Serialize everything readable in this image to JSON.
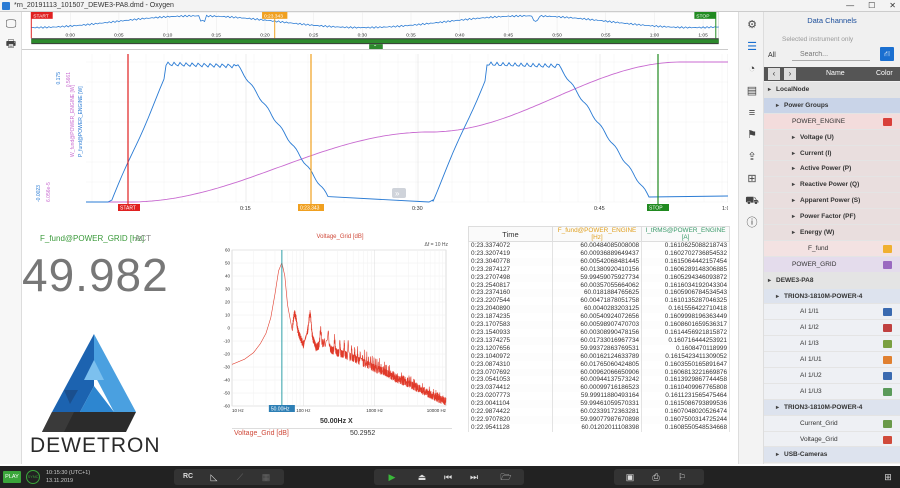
{
  "window": {
    "title": "*rn_20191113_101507_DEWE3-PA8.dmd - Oxygen",
    "controls": [
      "—",
      "☐",
      "✕"
    ]
  },
  "overview": {
    "start_marker": "START",
    "cursor_marker": "0:23.343",
    "stop_marker": "STOP",
    "ticks": [
      "0:00",
      "0:05",
      "0:10",
      "0:15",
      "0:20",
      "0:25",
      "0:30",
      "0:35",
      "0:40",
      "0:45",
      "0:50",
      "0:55",
      "1:00",
      "1:05"
    ]
  },
  "main_chart": {
    "axis_labels": [
      "W_fund@POWER_ENGINE [W]",
      "P_fund@POWER_ENGINE [W]"
    ],
    "y_ticks_top": [
      "0.5661",
      "0.175"
    ],
    "y_ticks_bottom": [
      "6.056e-5",
      "-0.0023"
    ],
    "start_marker": "START",
    "cursor_marker": "0:23.343",
    "stop_marker": "STOP",
    "x_ticks": [
      "0:15",
      "0:30",
      "0:45",
      "1:00"
    ],
    "colors": {
      "blue": "#2a7bd4",
      "magenta": "#c86ad0",
      "red": "#e02020",
      "orange": "#f0a020",
      "green": "#208a20"
    }
  },
  "fund_panel": {
    "label": "F_fund@POWER_GRID [Hz]",
    "mode": "ACT",
    "value": "49.982"
  },
  "logo": {
    "text": "DEWETRON"
  },
  "fft": {
    "title": "Voltage_Grid [dB]",
    "delta_label": "Δf = 10 Hz",
    "y_ticks": [
      "60",
      "50",
      "40",
      "30",
      "20",
      "10",
      "0",
      "-10",
      "-20",
      "-30",
      "-40",
      "-50",
      "-60"
    ],
    "x_ticks": [
      "10 Hz",
      "100 Hz",
      "1000 Hz",
      "10000 Hz"
    ],
    "cursor_label": "50.00Hz",
    "cursor_x_label": "50.00Hz X",
    "channel_name": "Voltage_Grid [dB]",
    "channel_value": "50.2952",
    "chart_data": {
      "type": "line",
      "title": "Voltage_Grid [dB]",
      "xlabel": "",
      "ylabel": "",
      "x_scale": "log",
      "xlim": [
        10,
        10000
      ],
      "ylim": [
        -60,
        60
      ],
      "series": [
        {
          "x": [
            10,
            15,
            20,
            25,
            30,
            35,
            40,
            45,
            50,
            55,
            60,
            70,
            80,
            100,
            120,
            150,
            200,
            250,
            300,
            400,
            500,
            700,
            1000,
            1500,
            2000,
            3000,
            5000,
            7000,
            10000
          ],
          "y": [
            -28,
            -24,
            -19,
            -12,
            -4,
            8,
            26,
            44,
            50.3,
            40,
            18,
            -2,
            5,
            -8,
            6,
            -10,
            -6,
            -12,
            -14,
            -16,
            -18,
            -22,
            -26,
            -30,
            -34,
            -38,
            -44,
            -48,
            -52
          ]
        }
      ],
      "grid": true,
      "color": "#e03a2a"
    }
  },
  "table": {
    "headers": [
      "Time",
      "F_fund@POWER_ENGINE [Hz]",
      "I_tRMS@POWER_ENGINE [A]"
    ],
    "rows": [
      [
        "0:23.3374072",
        "60.00484085008008",
        "0.1610625088218743"
      ],
      [
        "0:23.3207419",
        "60.00936889649437",
        "0.1602702736854532"
      ],
      [
        "0:23.3040778",
        "60.00542068481445",
        "0.1615064442157454"
      ],
      [
        "0:23.2874127",
        "60.01380920410156",
        "0.1606289148306885"
      ],
      [
        "0:23.2707498",
        "59.99459075927734",
        "0.1605294346093872"
      ],
      [
        "0:23.2540817",
        "60.00357055664062",
        "0.1616034192043304"
      ],
      [
        "0:23.2374160",
        "60.0181884765625",
        "0.1605906784534543"
      ],
      [
        "0:23.2207544",
        "60.00471878051758",
        "0.1610135287046325"
      ],
      [
        "0:23.2040890",
        "60.0040283203125",
        "0.161556422710418"
      ],
      [
        "0:23.1874235",
        "60.00540924072656",
        "0.1609998196363449"
      ],
      [
        "0:23.1707583",
        "60.00598907470703",
        "0.1608601659536317"
      ],
      [
        "0:23.1540933",
        "60.00308990478156",
        "0.1614456921815872"
      ],
      [
        "0:23.1374275",
        "60.01733016967734",
        "0.160716444253921"
      ],
      [
        "0:23.1207656",
        "59.99372863769531",
        "0.1608470118999"
      ],
      [
        "0:23.1040972",
        "60.00162124633789",
        "0.1615423411309052"
      ],
      [
        "0:23.0874310",
        "60.01765060424805",
        "0.1603550165891647"
      ],
      [
        "0:23.0707692",
        "60.00962066650906",
        "0.1606813221669876"
      ],
      [
        "0:23.0541053",
        "60.00944137573242",
        "0.1613929867744458"
      ],
      [
        "0:23.0374412",
        "60.00099716186523",
        "0.1610409967765808"
      ],
      [
        "0:23.0207773",
        "59.99911880493164",
        "0.1611231565475464"
      ],
      [
        "0:23.0041104",
        "59.99461059570331",
        "0.1615086793899536"
      ],
      [
        "0:22.9874422",
        "60.02339172363281",
        "0.1607048020526474"
      ],
      [
        "0:22.9707820",
        "59.99077987670898",
        "0.1607500314725244"
      ],
      [
        "0:22.9541128",
        "60.01202011108398",
        "0.1608550548534668"
      ]
    ]
  },
  "channels": {
    "title": "Data Channels",
    "selected_only": "Selected instrument only",
    "filter_all": "All",
    "search_placeholder": "Search...",
    "col_name": "Name",
    "col_color": "Color",
    "tree": [
      {
        "label": "LocalNode",
        "level": 0,
        "bold": true,
        "bg": "#e4e4e4",
        "color": null
      },
      {
        "label": "Power Groups",
        "level": 1,
        "bold": true,
        "bg": "#c9d4e8",
        "color": null
      },
      {
        "label": "POWER_ENGINE",
        "level": 2,
        "bold": false,
        "bg": "#f3dcdc",
        "color": "#d9403a"
      },
      {
        "label": "Voltage (U)",
        "level": 3,
        "bold": true,
        "bg": "#e9dede",
        "color": null
      },
      {
        "label": "Current (I)",
        "level": 3,
        "bold": true,
        "bg": "#e9dede",
        "color": null
      },
      {
        "label": "Active Power (P)",
        "level": 3,
        "bold": true,
        "bg": "#e9dede",
        "color": null
      },
      {
        "label": "Reactive Power (Q)",
        "level": 3,
        "bold": true,
        "bg": "#e9dede",
        "color": null
      },
      {
        "label": "Apparent Power (S)",
        "level": 3,
        "bold": true,
        "bg": "#e9dede",
        "color": null
      },
      {
        "label": "Power Factor (PF)",
        "level": 3,
        "bold": true,
        "bg": "#e9dede",
        "color": null
      },
      {
        "label": "Energy (W)",
        "level": 3,
        "bold": true,
        "bg": "#e9dede",
        "color": null
      },
      {
        "label": "F_fund",
        "level": 4,
        "bold": false,
        "bg": "#f3e2e2",
        "color": "#f0b030"
      },
      {
        "label": "POWER_GRID",
        "level": 2,
        "bold": false,
        "bg": "#e4dcec",
        "color": "#9a6ac0"
      },
      {
        "label": "DEWE3-PA8",
        "level": 0,
        "bold": true,
        "bg": "#e4e4e4",
        "color": null
      },
      {
        "label": "TRION3-1810M-POWER-4",
        "level": 1,
        "bold": true,
        "bg": "#dde3ee",
        "color": null
      },
      {
        "label": "AI 1/I1",
        "level": 3,
        "bold": false,
        "bg": "#eef0f4",
        "color": "#3a6ab0"
      },
      {
        "label": "AI 1/I2",
        "level": 3,
        "bold": false,
        "bg": "#eef0f4",
        "color": "#c04040"
      },
      {
        "label": "AI 1/I3",
        "level": 3,
        "bold": false,
        "bg": "#eef0f4",
        "color": "#7aa040"
      },
      {
        "label": "AI 1/U1",
        "level": 3,
        "bold": false,
        "bg": "#eef0f4",
        "color": "#e08030"
      },
      {
        "label": "AI 1/U2",
        "level": 3,
        "bold": false,
        "bg": "#eef0f4",
        "color": "#3a6ab0"
      },
      {
        "label": "AI 1/U3",
        "level": 3,
        "bold": false,
        "bg": "#eef0f4",
        "color": "#5a9a5a"
      },
      {
        "label": "TRION3-1810M-POWER-4",
        "level": 1,
        "bold": true,
        "bg": "#dde3ee",
        "color": null
      },
      {
        "label": "Current_Grid",
        "level": 3,
        "bold": false,
        "bg": "#eef0f4",
        "color": "#6a9a4a"
      },
      {
        "label": "Voltage_Grid",
        "level": 3,
        "bold": false,
        "bg": "#eef0f4",
        "color": "#d04a3a"
      },
      {
        "label": "USB-Cameras",
        "level": 1,
        "bold": true,
        "bg": "#dde3ee",
        "color": null
      }
    ]
  },
  "bottombar": {
    "play_label": "PLAY",
    "sync_label": "SYNC",
    "time_line1": "10:15:30 (UTC+1)",
    "time_line2": "13.11.2019",
    "rc_label": "RC"
  }
}
